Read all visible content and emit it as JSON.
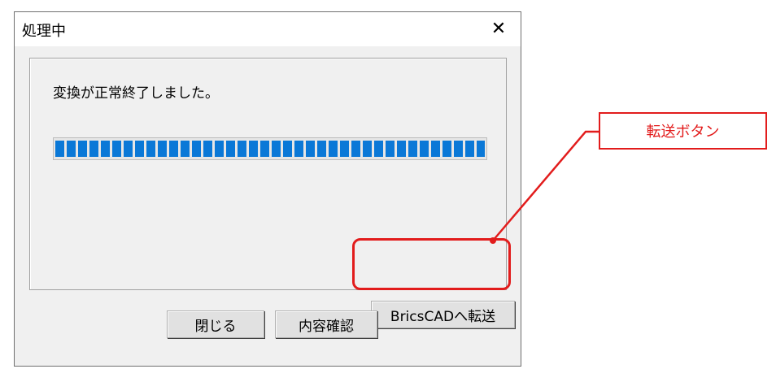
{
  "dialog": {
    "title": "処理中",
    "close_icon": "close-icon",
    "message": "変換が正常終了しました。",
    "progress": 1.0,
    "transfer_button_label": "BricsCADへ転送",
    "buttons": {
      "close_label": "閉じる",
      "check_label": "内容確認"
    }
  },
  "annotation": {
    "callout_label": "転送ボタン",
    "color": "#e21c1c"
  },
  "colors": {
    "progress_fill": "#0a78d7",
    "dialog_bg": "#f0f0f0"
  }
}
